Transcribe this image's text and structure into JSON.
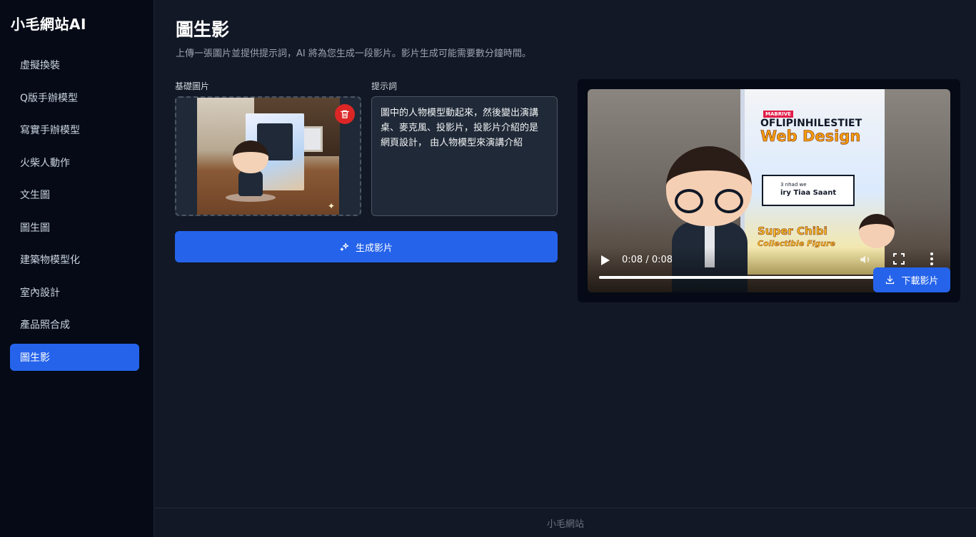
{
  "app": {
    "brand": "小毛網站AI"
  },
  "sidebar": {
    "items": [
      {
        "label": "虛擬換裝",
        "active": false
      },
      {
        "label": "Q版手辦模型",
        "active": false
      },
      {
        "label": "寫實手辦模型",
        "active": false
      },
      {
        "label": "火柴人動作",
        "active": false
      },
      {
        "label": "文生圖",
        "active": false
      },
      {
        "label": "圖生圖",
        "active": false
      },
      {
        "label": "建築物模型化",
        "active": false
      },
      {
        "label": "室內設計",
        "active": false
      },
      {
        "label": "產品照合成",
        "active": false
      },
      {
        "label": "圖生影",
        "active": true
      }
    ]
  },
  "main": {
    "title": "圖生影",
    "subtitle": "上傳一張圖片並提供提示詞，AI 將為您生成一段影片。影片生成可能需要數分鐘時間。",
    "base_image_label": "基礎圖片",
    "prompt_label": "提示詞",
    "prompt_value": "圖中的人物模型動起來，然後變出演講桌、麥克風、投影片，投影片介紹的是 網頁設計， 由人物模型來演講介紹",
    "generate_label": "生成影片",
    "download_label": "下載影片"
  },
  "video": {
    "time_display": "0:08 / 0:08",
    "progress_fraction": 0.97,
    "poster_tag": "MABRIVE",
    "poster_title_1": "OFLIPINHILESTIET",
    "poster_title_2": "Web Design",
    "poster_card_small": "3 nhad we",
    "poster_card_main": "iry Tiaa Saant",
    "poster_foot_1": "Super Chibi",
    "poster_foot_2": "Collectible Figure"
  },
  "footer": {
    "text": "小毛網站"
  },
  "colors": {
    "accent": "#2563eb",
    "sidebar_bg": "#050a16",
    "main_bg": "#121826",
    "danger": "#dc2626"
  },
  "icons": {
    "delete": "trash-icon",
    "generate": "sparkles-icon",
    "download": "download-icon",
    "play": "play-icon",
    "volume": "volume-icon",
    "fullscreen": "fullscreen-icon",
    "more": "more-vertical-icon"
  }
}
